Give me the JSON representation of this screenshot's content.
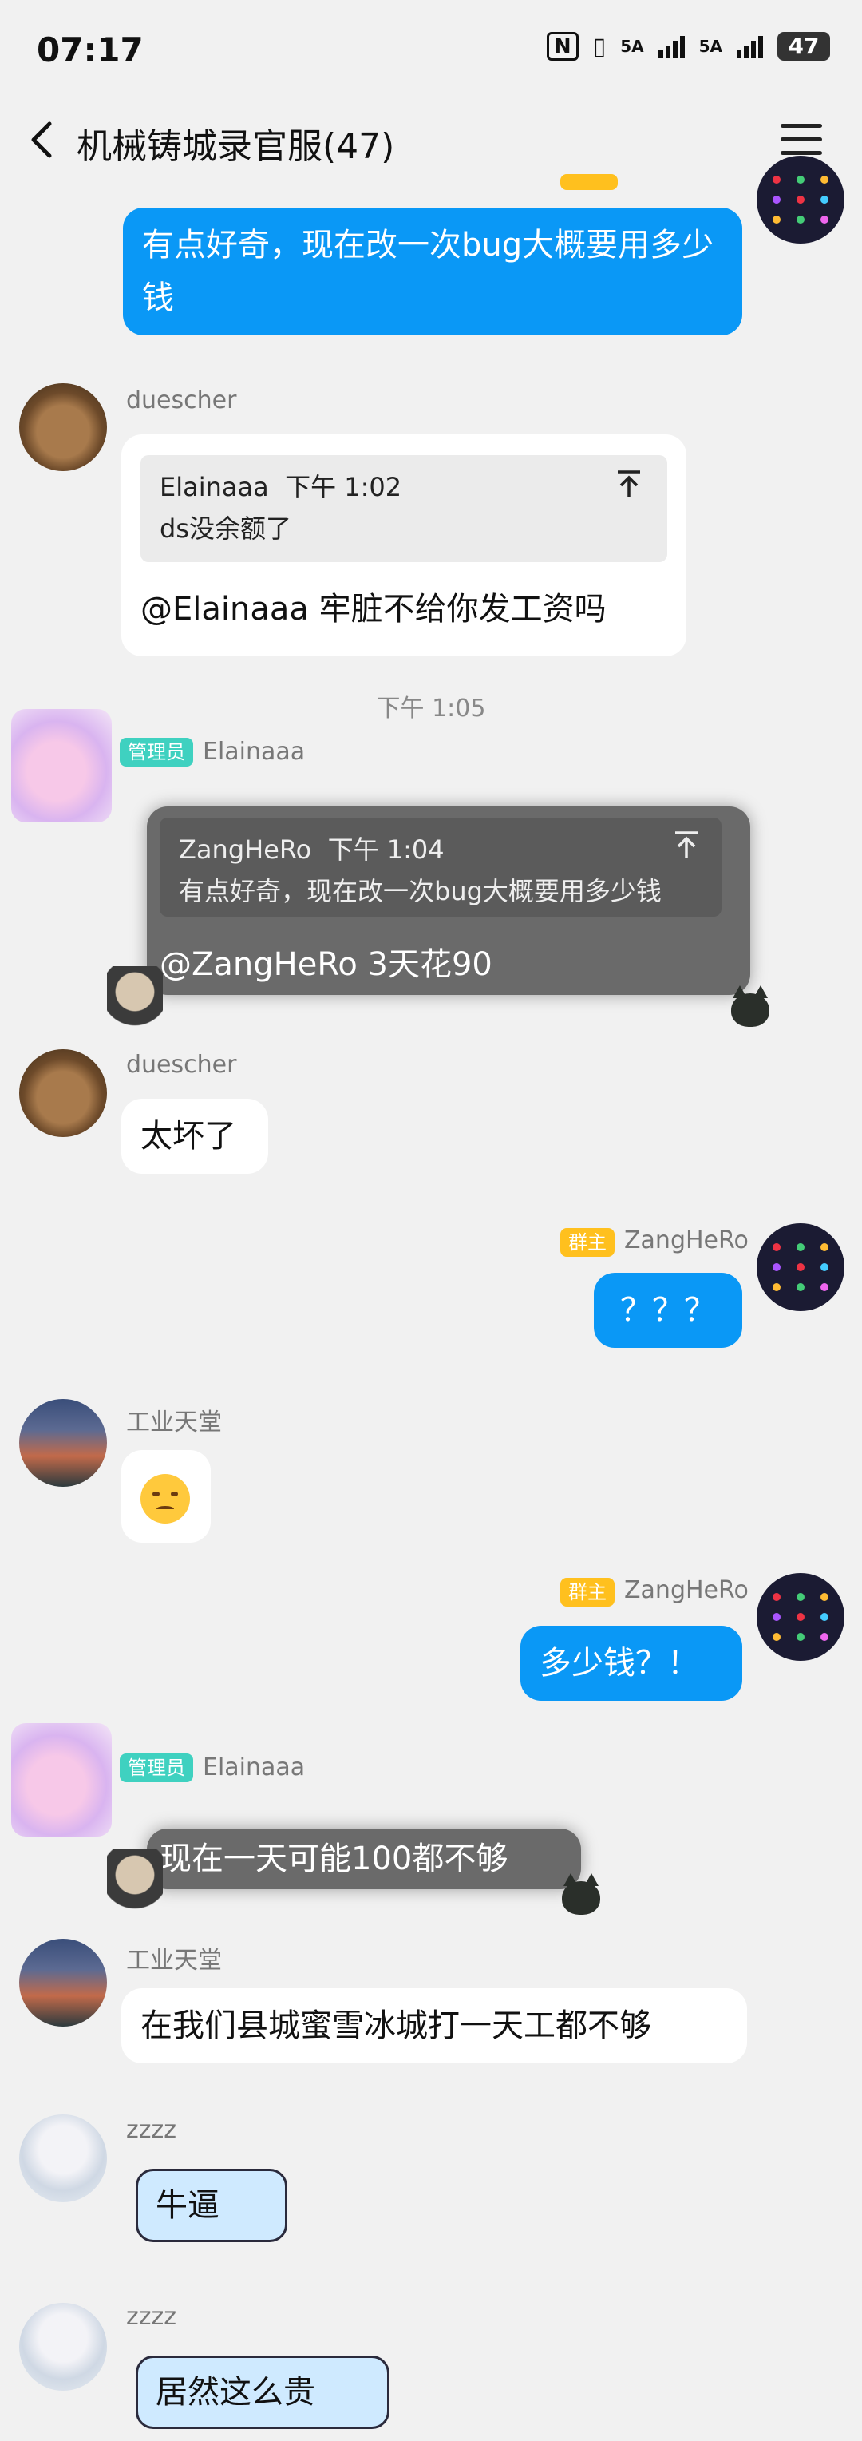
{
  "status_bar": {
    "time": "07:17",
    "nfc": "N",
    "vibrate": ")0(",
    "signal1_label": "5A",
    "signal2_label": "5A",
    "battery": "47"
  },
  "header": {
    "title": "机械铸城录官服(47)",
    "back_icon": "chevron-left-icon",
    "menu_icon": "hamburger-menu-icon"
  },
  "messages": {
    "m1": {
      "text": "有点好奇，现在改一次bug大概要用多少钱"
    },
    "m2": {
      "sender": "duescher",
      "quote_author": "Elainaaa",
      "quote_time": "下午 1:02",
      "quote_text": "ds没余额了",
      "text": "@Elainaaa 牢脏不给你发工资吗"
    },
    "ts1": "下午 1:05",
    "m3": {
      "badge": "管理员",
      "sender": "Elainaaa",
      "quote_author": "ZangHeRo",
      "quote_time": "下午 1:04",
      "quote_text": "有点好奇，现在改一次bug大概要用多少钱",
      "text": "@ZangHeRo 3天花90"
    },
    "m4": {
      "sender": "duescher",
      "text": "太坏了"
    },
    "m5": {
      "badge": "群主",
      "sender": "ZangHeRo",
      "text": "？？？"
    },
    "m6": {
      "sender": "工业天堂",
      "emoji": "frown-emoji"
    },
    "m7": {
      "badge": "群主",
      "sender": "ZangHeRo",
      "text": "多少钱？！"
    },
    "m8": {
      "badge": "管理员",
      "sender": "Elainaaa",
      "text": "现在一天可能100都不够"
    },
    "m9": {
      "sender": "工业天堂",
      "text": "在我们县城蜜雪冰城打一天工都不够"
    },
    "m10": {
      "sender": "zzzz",
      "text": "牛逼"
    },
    "m11": {
      "sender": "zzzz",
      "text": "居然这么贵"
    }
  },
  "colors": {
    "background": "#f1f1f1",
    "outgoing_bubble": "#0a98f6",
    "incoming_bubble": "#ffffff",
    "admin_badge": "#3fd1c0",
    "owner_badge": "#ffc01e"
  }
}
